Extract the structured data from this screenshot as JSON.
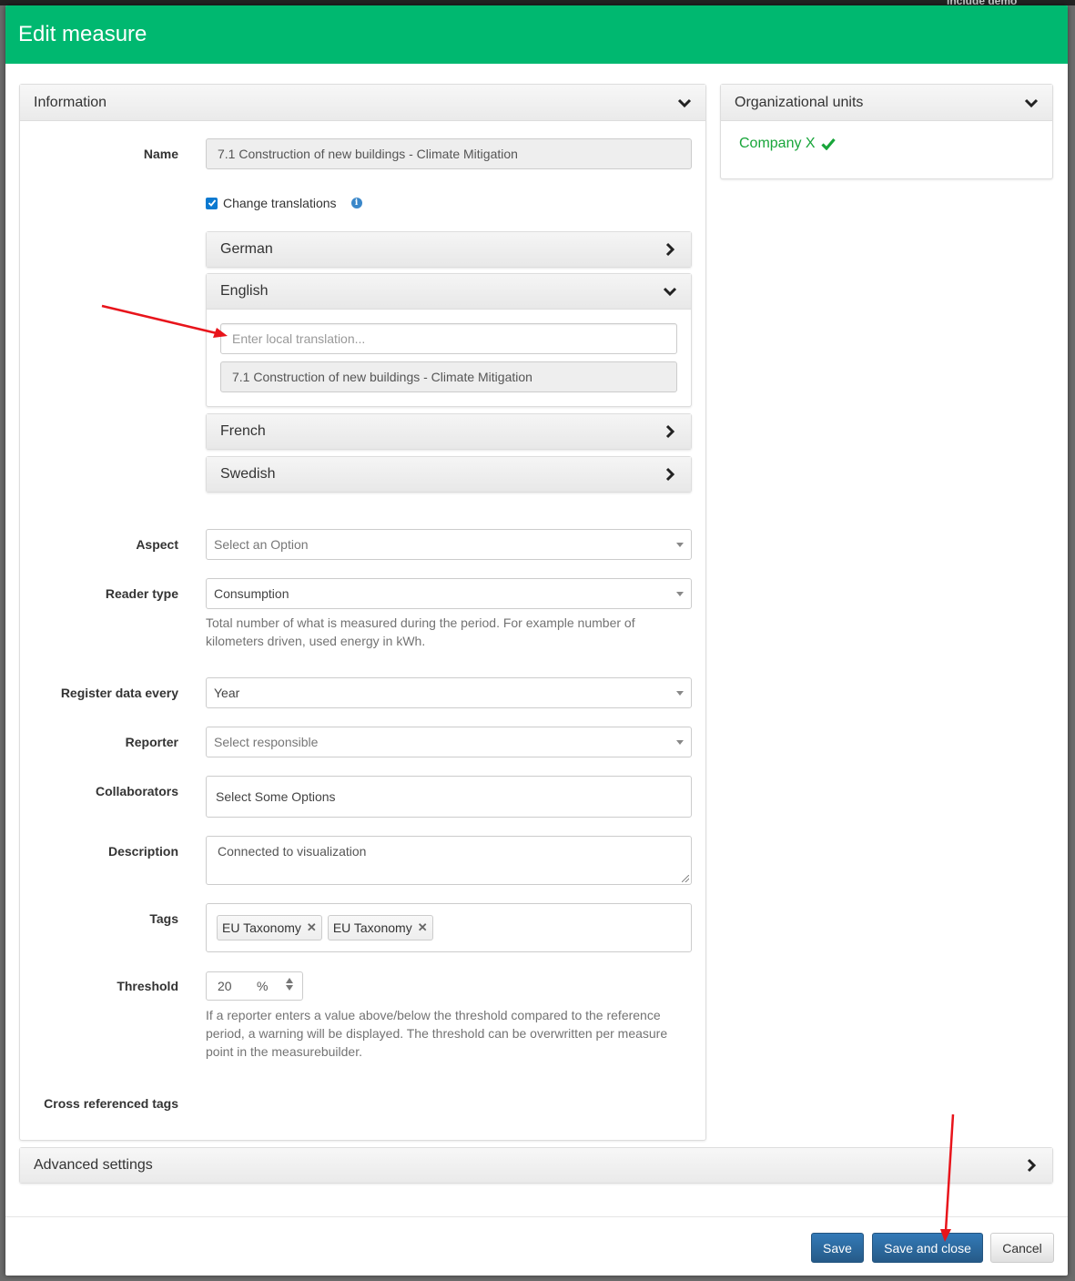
{
  "background": {
    "corner_text": "include demo"
  },
  "modal": {
    "title": "Edit measure",
    "header_color": "#00b870"
  },
  "information": {
    "heading": "Information",
    "name": {
      "label": "Name",
      "value": "7.1 Construction of new buildings -  Climate Mitigation"
    },
    "change_translations": {
      "label": "Change translations",
      "checked": true
    },
    "languages": [
      {
        "name": "German",
        "expanded": false
      },
      {
        "name": "English",
        "expanded": true,
        "placeholder": "Enter local translation...",
        "default_value": "7.1 Construction of new buildings -  Climate Mitigation"
      },
      {
        "name": "French",
        "expanded": false
      },
      {
        "name": "Swedish",
        "expanded": false
      }
    ],
    "aspect": {
      "label": "Aspect",
      "value": "Select an Option"
    },
    "reader_type": {
      "label": "Reader type",
      "value": "Consumption",
      "help": "Total number of what is measured during the period. For example number of kilometers driven, used energy in kWh."
    },
    "register_every": {
      "label": "Register data every",
      "value": "Year"
    },
    "reporter": {
      "label": "Reporter",
      "value": "Select responsible"
    },
    "collaborators": {
      "label": "Collaborators",
      "value": "Select Some Options"
    },
    "description": {
      "label": "Description",
      "value": "Connected to visualization"
    },
    "tags": {
      "label": "Tags",
      "items": [
        "EU Taxonomy",
        "EU Taxonomy"
      ]
    },
    "threshold": {
      "label": "Threshold",
      "value": "20",
      "unit": "%",
      "help": "If a reporter enters a value above/below the threshold compared to the reference period, a warning will be displayed. The threshold can be overwritten per measure point in the measurebuilder."
    },
    "cross_ref": {
      "label": "Cross referenced tags"
    }
  },
  "org_units": {
    "heading": "Organizational units",
    "company": "Company X",
    "company_color": "#18a53a"
  },
  "advanced": {
    "heading": "Advanced settings"
  },
  "footer": {
    "save": "Save",
    "save_close": "Save and close",
    "cancel": "Cancel"
  },
  "annotation_color": "#e8141b"
}
